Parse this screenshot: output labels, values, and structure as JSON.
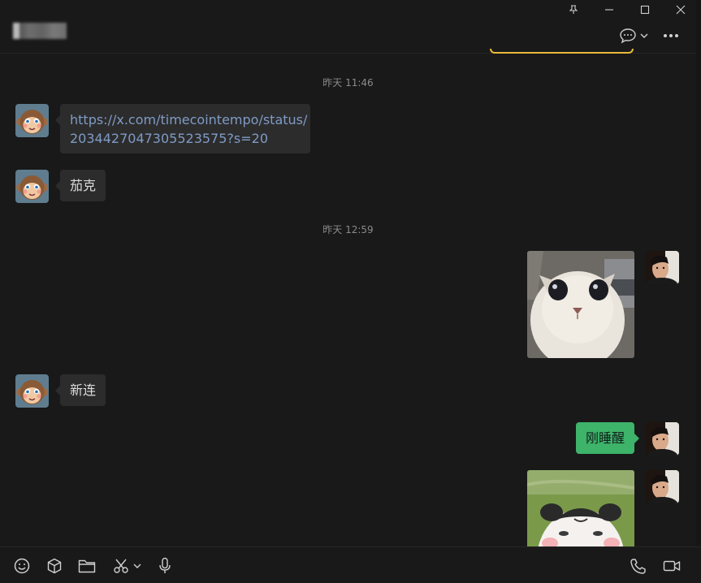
{
  "window": {
    "title_blurred": true
  },
  "messages": [
    {
      "type": "timestamp",
      "text": "昨天 11:46"
    },
    {
      "type": "text",
      "side": "left",
      "text_line1": "https://x.com/timecointempo/status/",
      "text_line2": "2034427047305523575?s=20"
    },
    {
      "type": "text",
      "side": "left",
      "text": "茄克"
    },
    {
      "type": "timestamp",
      "text": "昨天 12:59"
    },
    {
      "type": "image",
      "side": "right",
      "subject": "kitten"
    },
    {
      "type": "text",
      "side": "left",
      "text": "新连"
    },
    {
      "type": "text",
      "side": "right",
      "text": "刚睡醒"
    },
    {
      "type": "image",
      "side": "right",
      "subject": "panda-meme"
    }
  ],
  "colors": {
    "background": "#191919",
    "bubble_left": "#2c2c2c",
    "bubble_right": "#3eb36a",
    "link": "#7f9bc6",
    "hint_border": "#e8b93c"
  },
  "toolbar_icons": [
    "emoji-icon",
    "sticker-box-icon",
    "folder-icon",
    "scissors-icon",
    "microphone-icon",
    "phone-icon",
    "video-icon"
  ]
}
